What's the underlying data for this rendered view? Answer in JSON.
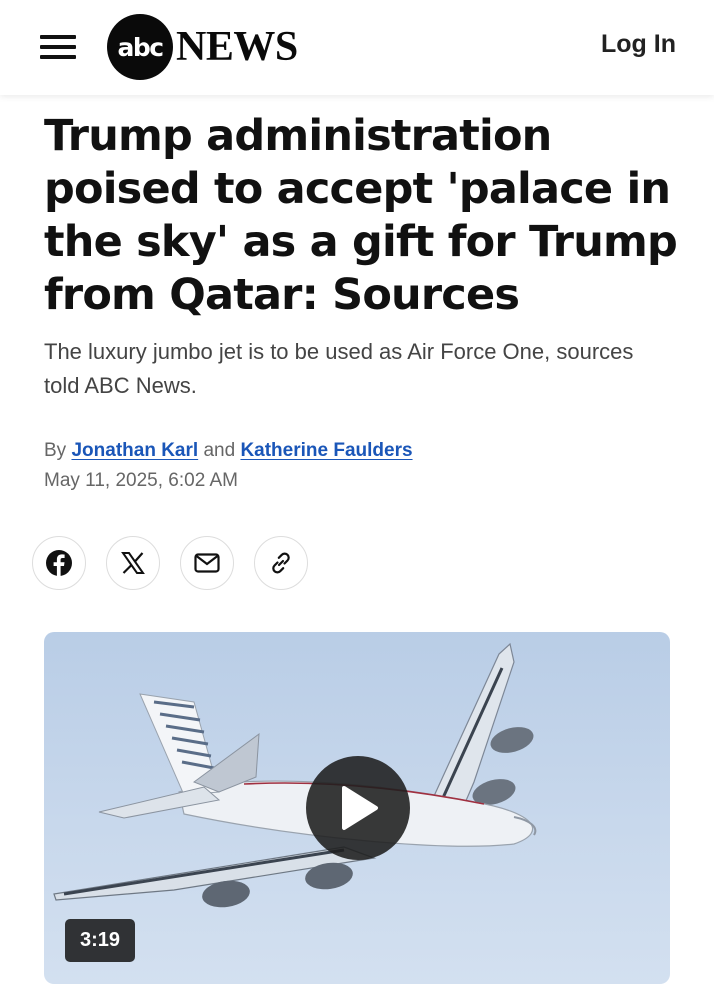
{
  "header": {
    "logo_abc": "abc",
    "logo_news": "NEWS",
    "login_label": "Log In"
  },
  "article": {
    "headline": "Trump administration poised to accept 'palace in the sky' as a gift for Trump from Qatar: Sources",
    "subheadline": "The luxury jumbo jet is to be used as Air Force One, sources told ABC News.",
    "byline_prefix": "By",
    "author_1": "Jonathan Karl",
    "byline_and": "and",
    "author_2": "Katherine Faulders",
    "date": "May 11, 2025, 6:02 AM"
  },
  "share": {
    "icons": [
      "facebook-icon",
      "x-icon",
      "mail-icon",
      "link-icon"
    ]
  },
  "video": {
    "duration": "3:19"
  },
  "colors": {
    "link": "#1a56b8",
    "text": "#111111",
    "muted": "#666666"
  }
}
